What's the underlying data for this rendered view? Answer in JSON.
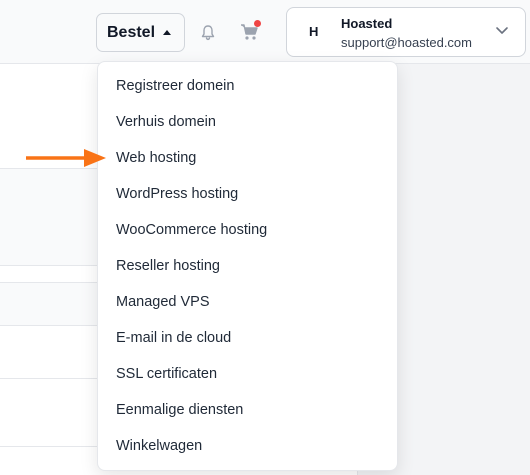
{
  "header": {
    "order_label": "Bestel",
    "notifications_icon": "bell-icon",
    "cart_icon": "cart-icon",
    "cart_badge_color": "#ef4444",
    "account": {
      "avatar_initial": "H",
      "name": "Hoasted",
      "email": "support@hoasted.com"
    }
  },
  "order_menu": {
    "items": [
      {
        "label": "Registreer domein"
      },
      {
        "label": "Verhuis domein"
      },
      {
        "label": "Web hosting"
      },
      {
        "label": "WordPress hosting"
      },
      {
        "label": "WooCommerce hosting"
      },
      {
        "label": "Reseller hosting"
      },
      {
        "label": "Managed VPS"
      },
      {
        "label": "E-mail in de cloud"
      },
      {
        "label": "SSL certificaten"
      },
      {
        "label": "Eenmalige diensten"
      },
      {
        "label": "Winkelwagen"
      }
    ]
  },
  "annotation": {
    "arrow_color": "#f97316",
    "points_to": "Web hosting"
  }
}
